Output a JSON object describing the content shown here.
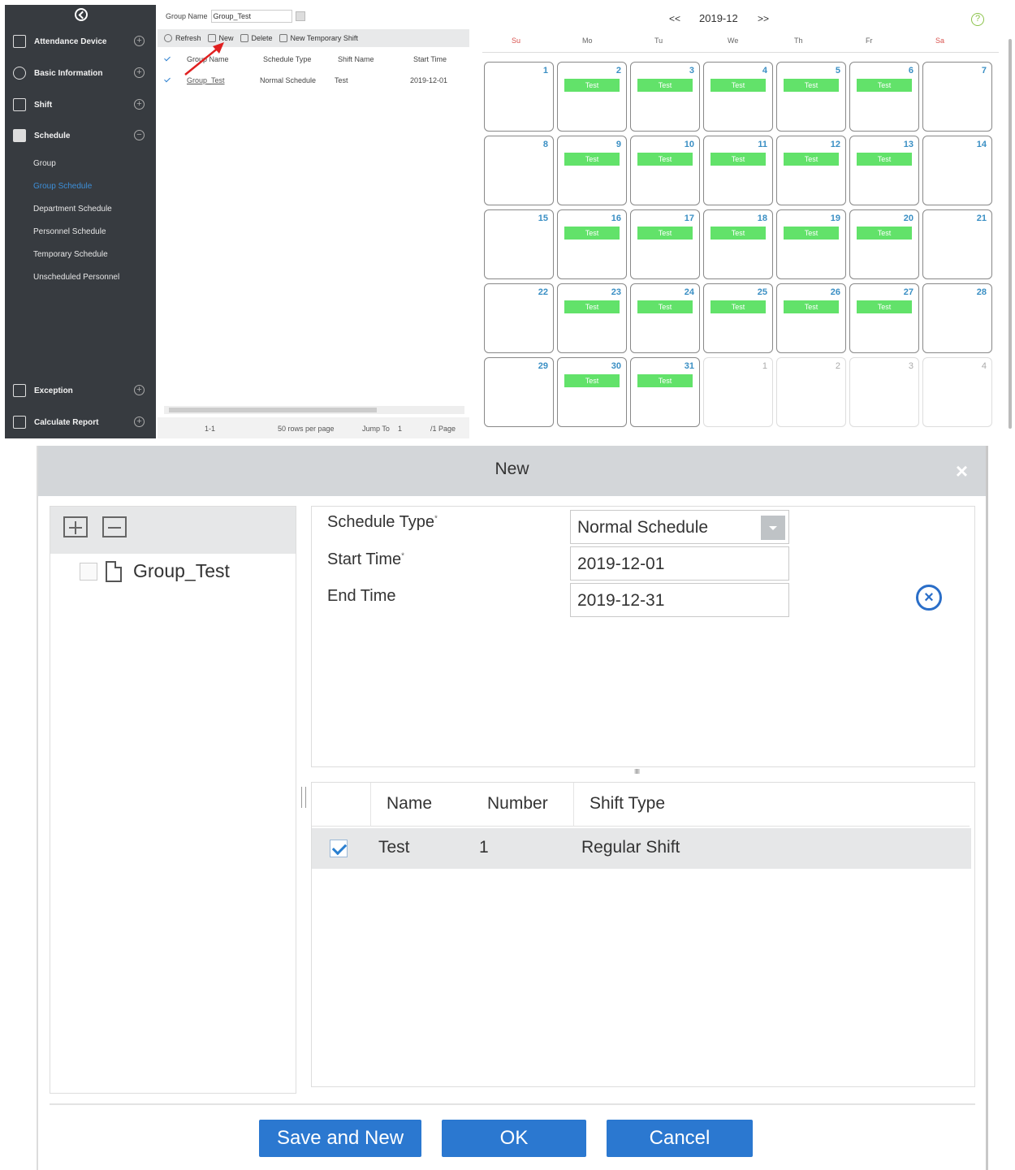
{
  "sidebar": {
    "items": [
      {
        "label": "Attendance Device",
        "toggle": "+"
      },
      {
        "label": "Basic Information",
        "toggle": "+"
      },
      {
        "label": "Shift",
        "toggle": "+"
      },
      {
        "label": "Schedule",
        "toggle": "−"
      },
      {
        "label": "Exception",
        "toggle": "+"
      },
      {
        "label": "Calculate Report",
        "toggle": "+"
      }
    ],
    "sub_items": [
      "Group",
      "Group Schedule",
      "Department Schedule",
      "Personnel Schedule",
      "Temporary Schedule",
      "Unscheduled Personnel"
    ]
  },
  "list": {
    "filter_label": "Group Name",
    "filter_value": "Group_Test",
    "toolbar": {
      "refresh": "Refresh",
      "new": "New",
      "delete": "Delete",
      "new_temp": "New Temporary Shift"
    },
    "columns": [
      "Group Name",
      "Schedule Type",
      "Shift Name",
      "Start Time"
    ],
    "row": {
      "group_name": "Group_Test",
      "schedule_type": "Normal Schedule",
      "shift_name": "Test",
      "start_time": "2019-12-01"
    },
    "pager": {
      "range": "1-1",
      "rows_per_page": "50 rows per page",
      "jump_to": "Jump To",
      "page_value": "1",
      "total": "/1 Page"
    }
  },
  "calendar": {
    "prev": "<<",
    "next": ">>",
    "month": "2019-12",
    "help": "?",
    "weekdays": [
      "Su",
      "Mo",
      "Tu",
      "We",
      "Th",
      "Fr",
      "Sa"
    ],
    "shift_label": "Test",
    "shift_color": "#62e26a",
    "weeks": [
      [
        "1",
        "2",
        "3",
        "4",
        "5",
        "6",
        "7"
      ],
      [
        "8",
        "9",
        "10",
        "11",
        "12",
        "13",
        "14"
      ],
      [
        "15",
        "16",
        "17",
        "18",
        "19",
        "20",
        "21"
      ],
      [
        "22",
        "23",
        "24",
        "25",
        "26",
        "27",
        "28"
      ],
      [
        "29",
        "30",
        "31",
        "1",
        "2",
        "3",
        "4"
      ]
    ]
  },
  "dialog": {
    "title": "New",
    "close": "×",
    "tree_node": "Group_Test",
    "form": {
      "schedule_type_label": "Schedule Type",
      "schedule_type_value": "Normal Schedule",
      "start_time_label": "Start Time",
      "start_time_value": "2019-12-01",
      "end_time_label": "End Time",
      "end_time_value": "2019-12-31",
      "required_mark": "*"
    },
    "splitter": "IIIII",
    "shift_table": {
      "columns": [
        "Name",
        "Number",
        "Shift Type"
      ],
      "row": {
        "name": "Test",
        "number": "1",
        "shift_type": "Regular Shift"
      }
    },
    "buttons": {
      "save_and_new": "Save and New",
      "ok": "OK",
      "cancel": "Cancel"
    },
    "accent": "#2b78d0"
  }
}
